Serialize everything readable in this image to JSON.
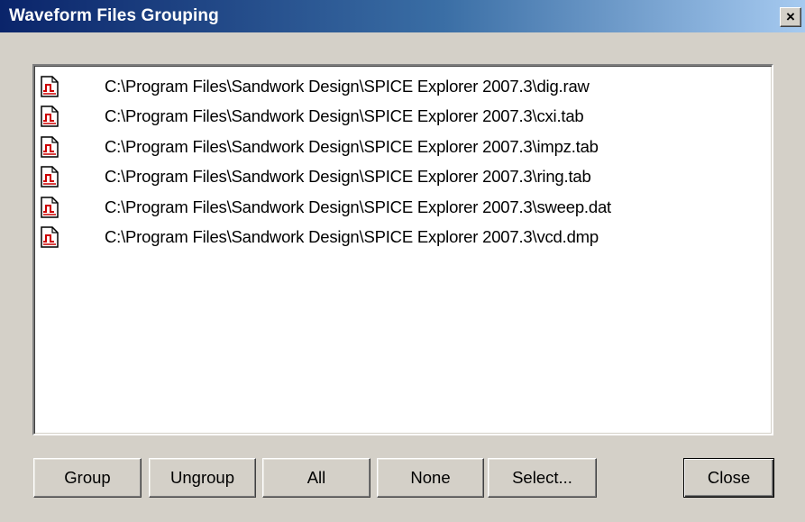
{
  "window": {
    "title": "Waveform Files Grouping",
    "close_glyph": "×"
  },
  "file_list": {
    "icon": "waveform-file-icon",
    "items": [
      "C:\\Program Files\\Sandwork Design\\SPICE Explorer 2007.3\\dig.raw",
      "C:\\Program Files\\Sandwork Design\\SPICE Explorer 2007.3\\cxi.tab",
      "C:\\Program Files\\Sandwork Design\\SPICE Explorer 2007.3\\impz.tab",
      "C:\\Program Files\\Sandwork Design\\SPICE Explorer 2007.3\\ring.tab",
      "C:\\Program Files\\Sandwork Design\\SPICE Explorer 2007.3\\sweep.dat",
      "C:\\Program Files\\Sandwork Design\\SPICE Explorer 2007.3\\vcd.dmp"
    ]
  },
  "buttons": {
    "group": "Group",
    "ungroup": "Ungroup",
    "all": "All",
    "none": "None",
    "select": "Select...",
    "close": "Close"
  },
  "colors": {
    "title_gradient_start": "#0a246a",
    "title_gradient_end": "#a6caf0",
    "dialog_face": "#d4d0c8",
    "icon_accent": "#cc0000"
  }
}
